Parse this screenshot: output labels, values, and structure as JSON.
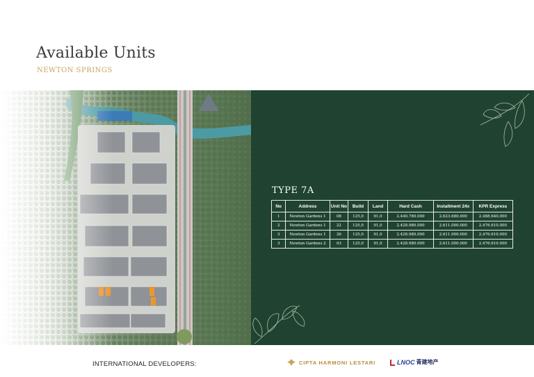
{
  "page": {
    "title": "Available Units",
    "subtitle": "NEWTON SPRINGS"
  },
  "type_title": "TYPE 7A",
  "table": {
    "headers": [
      "No",
      "Address",
      "Unit No",
      "Build",
      "Land",
      "Hard Cash",
      "Installment 24x",
      "KPR Express"
    ],
    "rows": [
      [
        "1",
        "Newton Gardens 1",
        "08",
        "125,0",
        "91,0",
        "2.440.780.000",
        "2.623.680.000",
        "2.488.640.000"
      ],
      [
        "2",
        "Newton Gardens 1",
        "22",
        "125,0",
        "91,0",
        "2.428.980.000",
        "2.611.000.000",
        "2.476.610.000"
      ],
      [
        "3",
        "Newton Gardens 1",
        "26",
        "125,0",
        "91,0",
        "2.428.980.000",
        "2.611.000.000",
        "2.476.610.000"
      ],
      [
        "3",
        "Newton Gardens 2",
        "03",
        "125,0",
        "91,0",
        "2.428.980.000",
        "2.611.000.000",
        "2.476.610.000"
      ]
    ]
  },
  "footer": {
    "label": "INTERNATIONAL DEVELOPERS:",
    "logo1": "CIPTA HARMONI LESTARI",
    "logo2_latin": "LNOC",
    "logo2_cn": "青建地产"
  },
  "colors": {
    "panel_green": "#1f4330",
    "accent_gold": "#c9a45d",
    "highlight_unit": "#f0962e"
  },
  "icons": [
    "cipta-harmoni-logo-icon",
    "lnoc-logo-icon"
  ]
}
